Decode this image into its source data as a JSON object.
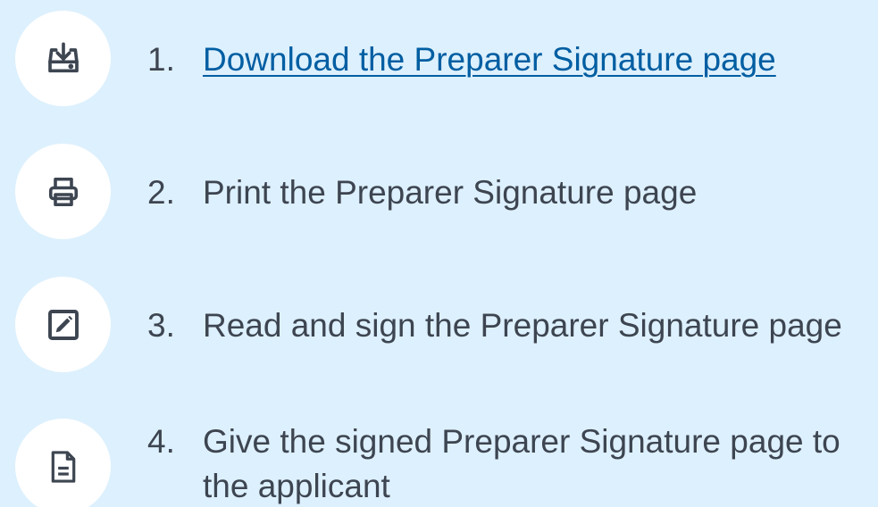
{
  "steps": [
    {
      "number": "1.",
      "text": "Download the Preparer Signature page",
      "icon": "download-icon",
      "is_link": true
    },
    {
      "number": "2.",
      "text": "Print the Preparer Signature page",
      "icon": "printer-icon",
      "is_link": false
    },
    {
      "number": "3.",
      "text": "Read and sign the Preparer Signature page",
      "icon": "edit-icon",
      "is_link": false
    },
    {
      "number": "4.",
      "text_line1": "Give the signed Preparer Signature page to",
      "text_line2": "the applicant",
      "icon": "file-icon",
      "is_link": false
    }
  ],
  "colors": {
    "background": "#ddf0fd",
    "circle": "#ffffff",
    "icon": "#3d4551",
    "text": "#3d4551",
    "link": "#005ea2"
  }
}
